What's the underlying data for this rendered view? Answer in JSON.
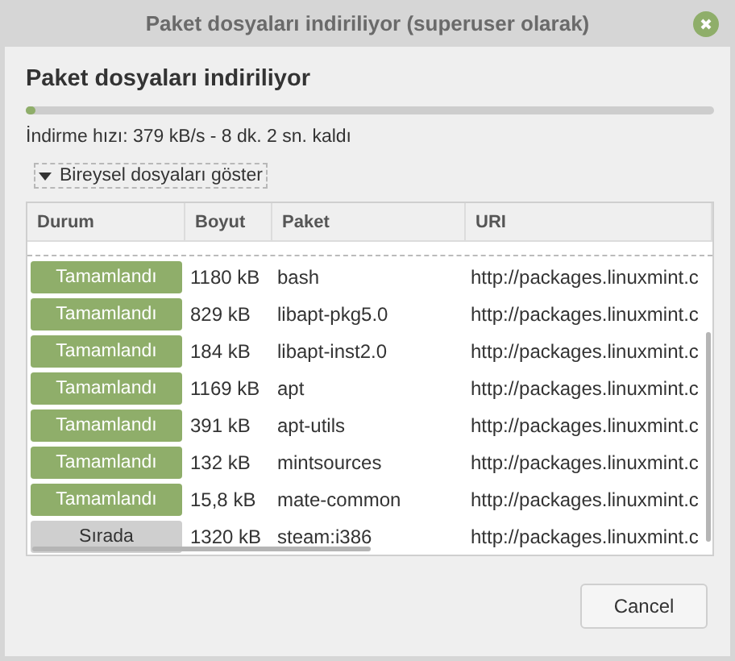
{
  "window": {
    "title": "Paket dosyaları indiriliyor (superuser olarak)"
  },
  "heading": "Paket dosyaları indiriliyor",
  "progress": {
    "level": 0.015
  },
  "status": "İndirme hızı: 379 kB/s - 8 dk. 2 sn. kaldı",
  "expander": {
    "label": "Bireysel dosyaları göster",
    "expanded": true
  },
  "table": {
    "columns": [
      "Durum",
      "Boyut",
      "Paket",
      "URI"
    ],
    "rows": [
      {
        "status": "Tamamlandı",
        "kind": "done",
        "size": "1180 kB",
        "package": "bash",
        "uri": "http://packages.linuxmint.c"
      },
      {
        "status": "Tamamlandı",
        "kind": "done",
        "size": "829 kB",
        "package": "libapt-pkg5.0",
        "uri": "http://packages.linuxmint.c"
      },
      {
        "status": "Tamamlandı",
        "kind": "done",
        "size": "184 kB",
        "package": "libapt-inst2.0",
        "uri": "http://packages.linuxmint.c"
      },
      {
        "status": "Tamamlandı",
        "kind": "done",
        "size": "1169 kB",
        "package": "apt",
        "uri": "http://packages.linuxmint.c"
      },
      {
        "status": "Tamamlandı",
        "kind": "done",
        "size": "391 kB",
        "package": "apt-utils",
        "uri": "http://packages.linuxmint.c"
      },
      {
        "status": "Tamamlandı",
        "kind": "done",
        "size": "132 kB",
        "package": "mintsources",
        "uri": "http://packages.linuxmint.c"
      },
      {
        "status": "Tamamlandı",
        "kind": "done",
        "size": "15,8 kB",
        "package": "mate-common",
        "uri": "http://packages.linuxmint.c"
      },
      {
        "status": "Sırada",
        "kind": "queued",
        "size": "1320 kB",
        "package": "steam:i386",
        "uri": "http://packages.linuxmint.c"
      }
    ]
  },
  "buttons": [
    "Cancel"
  ]
}
